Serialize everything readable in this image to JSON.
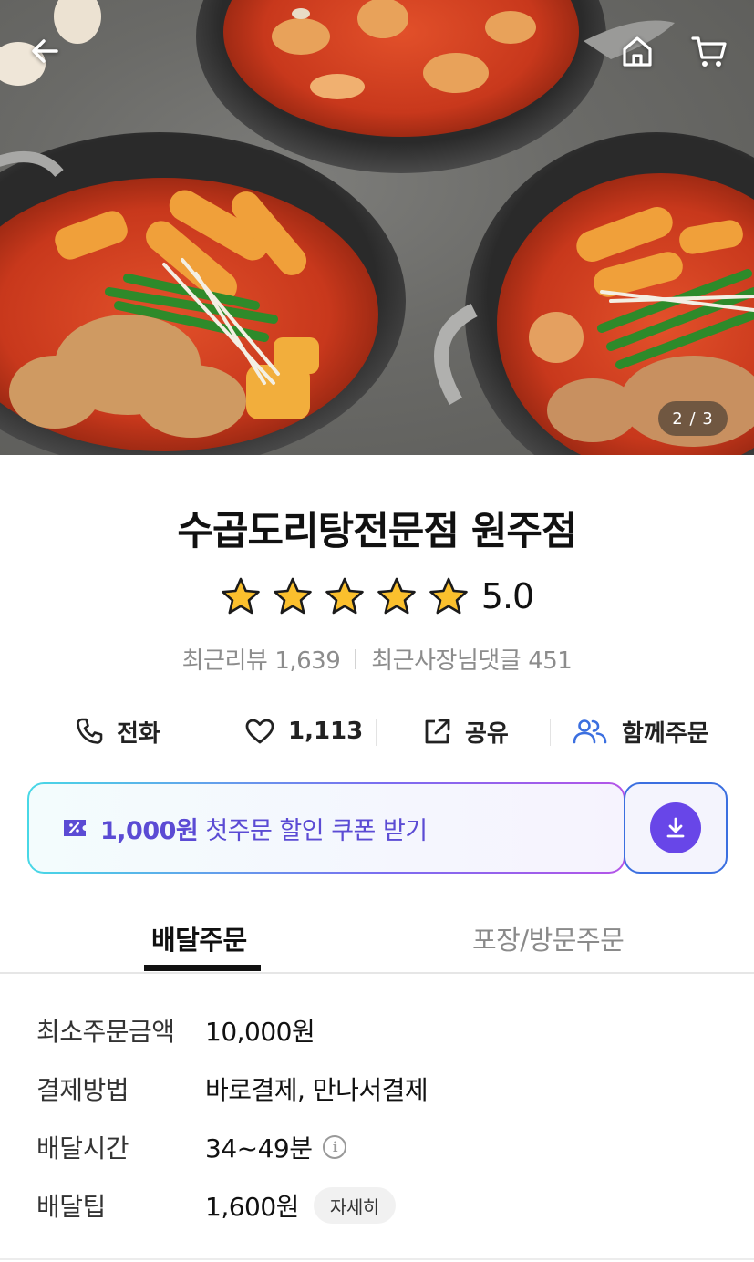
{
  "hero": {
    "pager": "2 / 3",
    "icons": {
      "back": "arrow-left-icon",
      "home": "home-icon",
      "cart": "cart-icon"
    }
  },
  "store": {
    "name": "수곱도리탕전문점 원주점",
    "rating": "5.0",
    "stars": 5,
    "recent_reviews_label": "최근리뷰",
    "recent_reviews_count": "1,639",
    "owner_replies_label": "최근사장님댓글",
    "owner_replies_count": "451"
  },
  "actions": {
    "call": "전화",
    "likes": "1,113",
    "share": "공유",
    "group_order": "함께주문"
  },
  "coupon": {
    "amount": "1,000원",
    "text": " 첫주문 할인 쿠폰 받기",
    "accent": "#5b4bd4",
    "download_color": "#6846e8"
  },
  "tabs": {
    "delivery": "배달주문",
    "pickup": "포장/방문주문"
  },
  "info": {
    "min_order_label": "최소주문금액",
    "min_order_value": "10,000원",
    "payment_label": "결제방법",
    "payment_value": "바로결제, 만나서결제",
    "delivery_time_label": "배달시간",
    "delivery_time_value": "34~49분",
    "delivery_tip_label": "배달팁",
    "delivery_tip_value": "1,600원",
    "detail_chip": "자세히"
  }
}
